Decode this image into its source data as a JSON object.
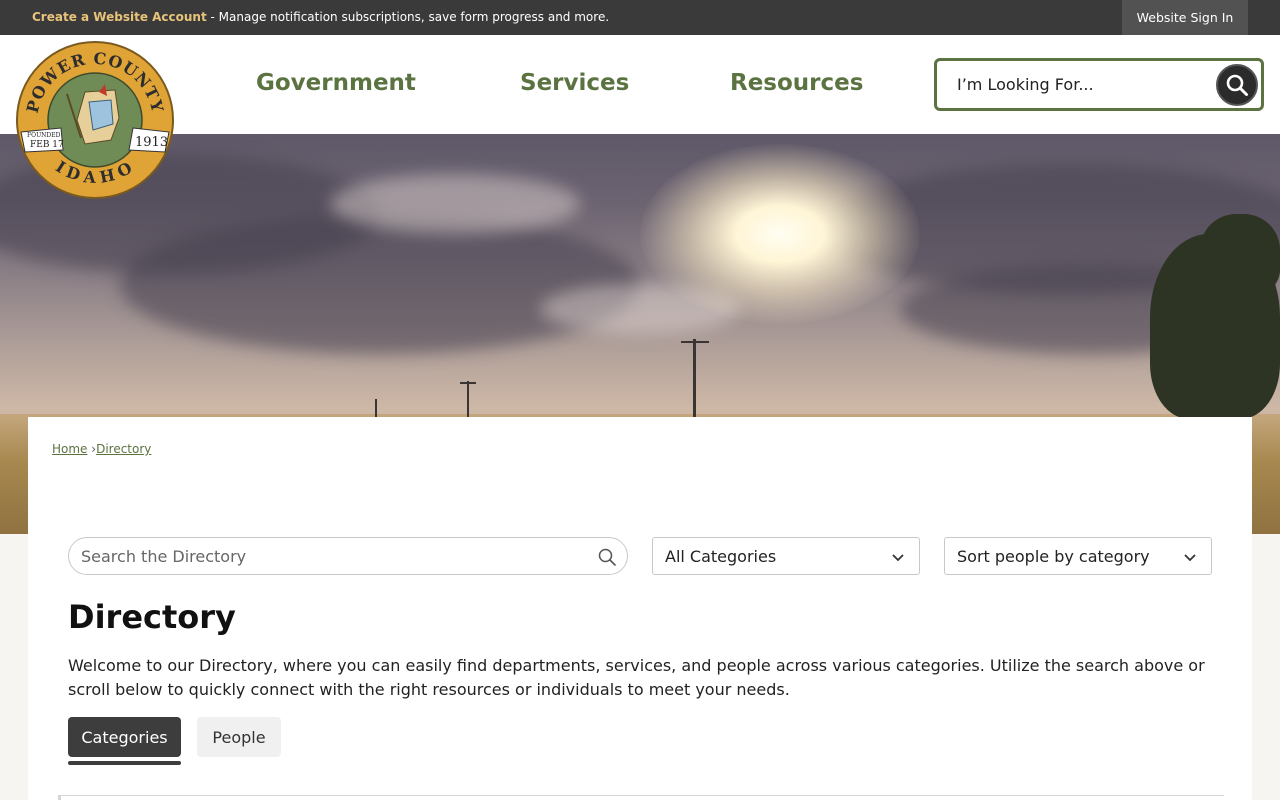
{
  "topbar": {
    "create_account_label": "Create a Website Account",
    "message": " - Manage notification subscriptions, save form progress and more.",
    "signin_label": "Website Sign In"
  },
  "logo": {
    "top_text": "POWER COUNTY",
    "bottom_text": "IDAHO",
    "founded_label": "FOUNDED",
    "founded_date": "FEB 17",
    "year": "1913"
  },
  "nav": {
    "items": [
      {
        "label": "Government"
      },
      {
        "label": "Services"
      },
      {
        "label": "Resources"
      }
    ]
  },
  "site_search": {
    "placeholder": "I’m Looking For..."
  },
  "breadcrumb": {
    "home": "Home",
    "separator": "›",
    "current": "Directory"
  },
  "directory": {
    "search_placeholder": "Search the Directory",
    "category_select": "All Categories",
    "sort_select": "Sort people by category",
    "title": "Directory",
    "intro": "Welcome to our Directory, where you can easily find departments, services, and people across various categories. Utilize the search above or scroll below to quickly connect with the right resources or individuals to meet your needs.",
    "tabs": [
      {
        "label": "Categories",
        "active": true
      },
      {
        "label": "People",
        "active": false
      }
    ]
  },
  "colors": {
    "brand_green": "#5b7340",
    "topbar": "#3a3a3a",
    "accent_link": "#e8c37a"
  }
}
